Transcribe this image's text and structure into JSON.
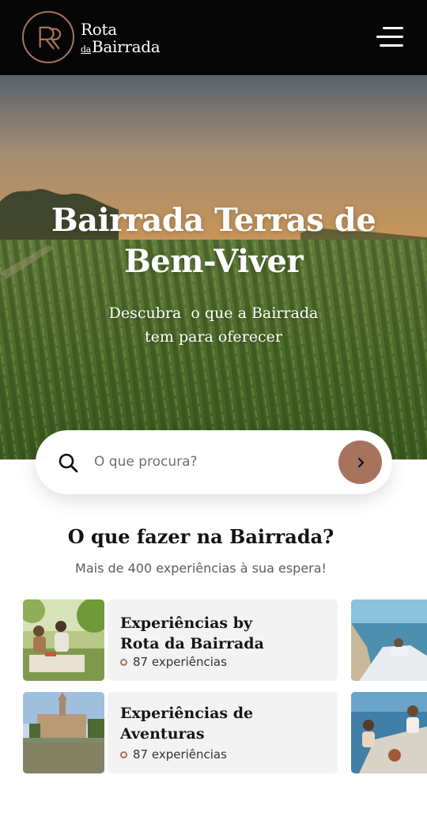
{
  "header": {
    "logo_line1": "Rota",
    "logo_da": "da",
    "logo_line2": "Bairrada",
    "colors": {
      "background": "#060606",
      "accent": "#a7735d"
    }
  },
  "hero": {
    "title_line1": "Bairrada Terras de",
    "title_line2": "Bem-Viver",
    "subtitle_line1": "Descubra  o que a Bairrada",
    "subtitle_line2": "tem para oferecer"
  },
  "search": {
    "placeholder": "O que procura?",
    "icon": "search-icon",
    "submit_icon": "chevron-right-icon"
  },
  "section": {
    "title": "O que fazer na Bairrada?",
    "subtitle": "Mais de 400 experiências à sua espera!"
  },
  "cards": [
    {
      "title_line1": "Experiências by",
      "title_line2": "Rota da Bairrada",
      "count": "87 experiências"
    },
    {
      "title_line1": "Experiências de",
      "title_line2": "Aventuras",
      "count": "87 experiências"
    }
  ]
}
